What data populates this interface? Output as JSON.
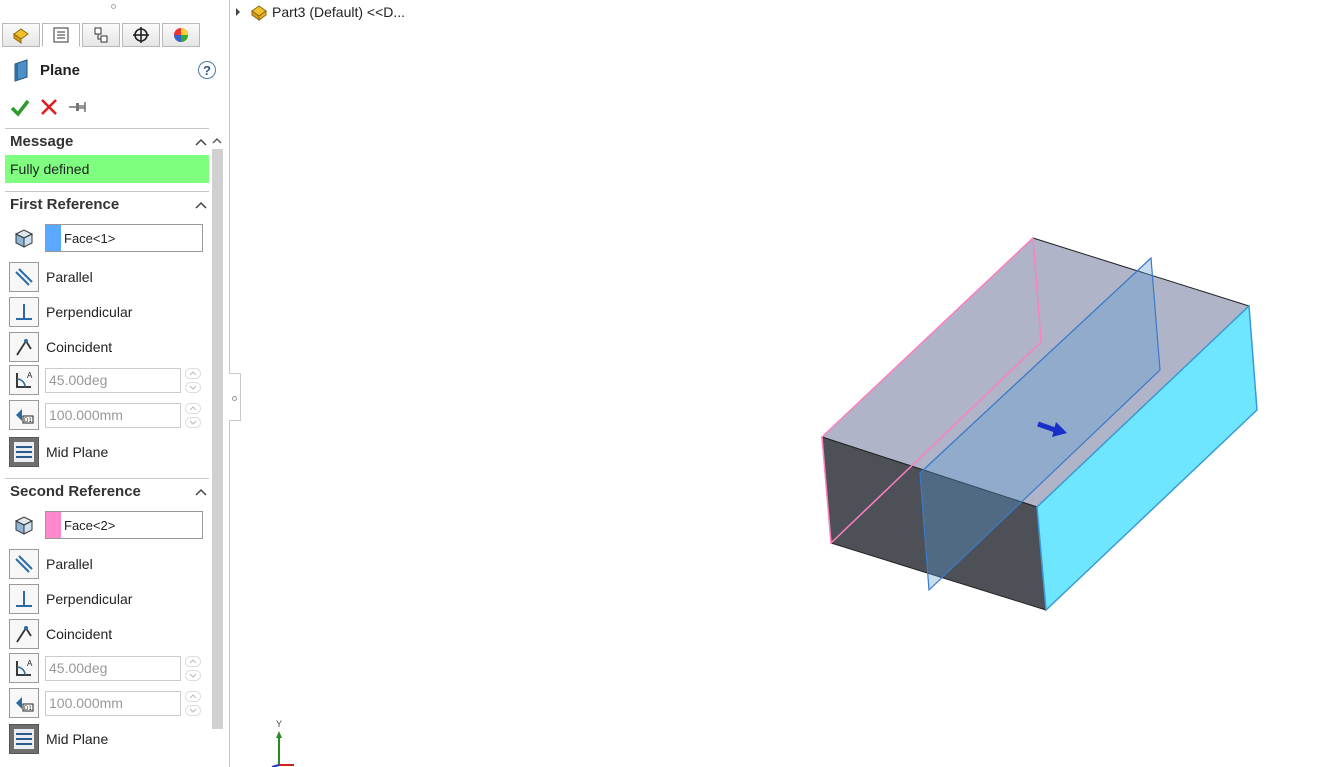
{
  "property_manager": {
    "title": "Plane",
    "tabs": [
      "feature-manager-tab",
      "property-manager-tab",
      "configuration-manager-tab",
      "dimxpert-manager-tab",
      "display-manager-tab"
    ],
    "help": "?",
    "actions": [
      "ok-checkmark",
      "cancel-x",
      "pushpin"
    ],
    "message_section": {
      "header": "Message",
      "text": "Fully defined",
      "color": "#7fff7f"
    },
    "first_reference": {
      "header": "First Reference",
      "selection": "Face<1>",
      "swatch_color": "#5aa8ff",
      "options": {
        "parallel": "Parallel",
        "perpendicular": "Perpendicular",
        "coincident": "Coincident",
        "mid_plane": "Mid Plane"
      },
      "angle": "45.00deg",
      "distance": "100.000mm"
    },
    "second_reference": {
      "header": "Second Reference",
      "selection": "Face<2>",
      "swatch_color": "#ff88cc",
      "options": {
        "parallel": "Parallel",
        "perpendicular": "Perpendicular",
        "coincident": "Coincident",
        "mid_plane": "Mid Plane"
      },
      "angle": "45.00deg",
      "distance": "100.000mm"
    }
  },
  "feature_tree": {
    "label": "Part3 (Default) <<D..."
  },
  "viewport": {
    "triad_y_label": "Y",
    "colors": {
      "top_face": "#b0b4c8",
      "front_face": "#4e5058",
      "right_face": "#6ee6ff",
      "plane": "#5a9ad8",
      "pink_edge": "#ff80c0",
      "arrow": "#1a2fc8"
    }
  }
}
